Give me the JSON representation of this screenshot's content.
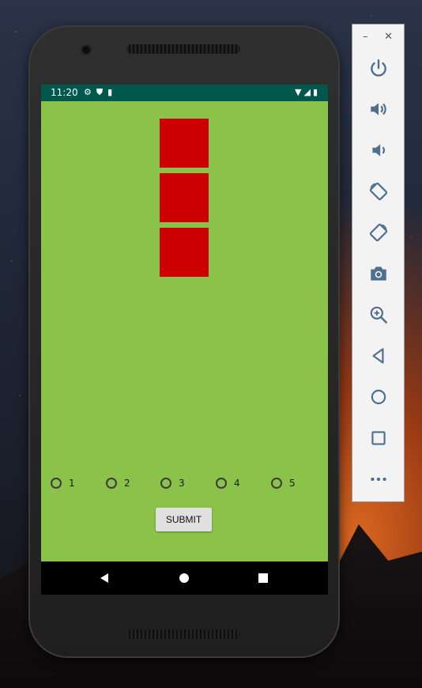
{
  "status_bar": {
    "time": "11:20",
    "left_icons": [
      "gear-icon",
      "shield-icon",
      "sd-card-icon"
    ],
    "right_icons": [
      "wifi-icon",
      "signal-icon",
      "battery-charging-icon"
    ]
  },
  "app": {
    "background_color": "#8bc34a",
    "box_color": "#cc0000",
    "boxes": [
      {
        "id": "box-1"
      },
      {
        "id": "box-2"
      },
      {
        "id": "box-3"
      }
    ],
    "radio_options": [
      {
        "label": "1",
        "checked": false
      },
      {
        "label": "2",
        "checked": false
      },
      {
        "label": "3",
        "checked": false
      },
      {
        "label": "4",
        "checked": false
      },
      {
        "label": "5",
        "checked": false
      }
    ],
    "submit_label": "SUBMIT"
  },
  "nav_bar": {
    "buttons": [
      "back-icon",
      "home-icon",
      "overview-icon"
    ]
  },
  "emulator_panel": {
    "minimize": "–",
    "close": "✕",
    "buttons": [
      "power-icon",
      "volume-up-icon",
      "volume-down-icon",
      "rotate-left-icon",
      "rotate-right-icon",
      "camera-icon",
      "zoom-icon",
      "back-icon",
      "home-icon",
      "overview-icon",
      "more-icon"
    ]
  }
}
